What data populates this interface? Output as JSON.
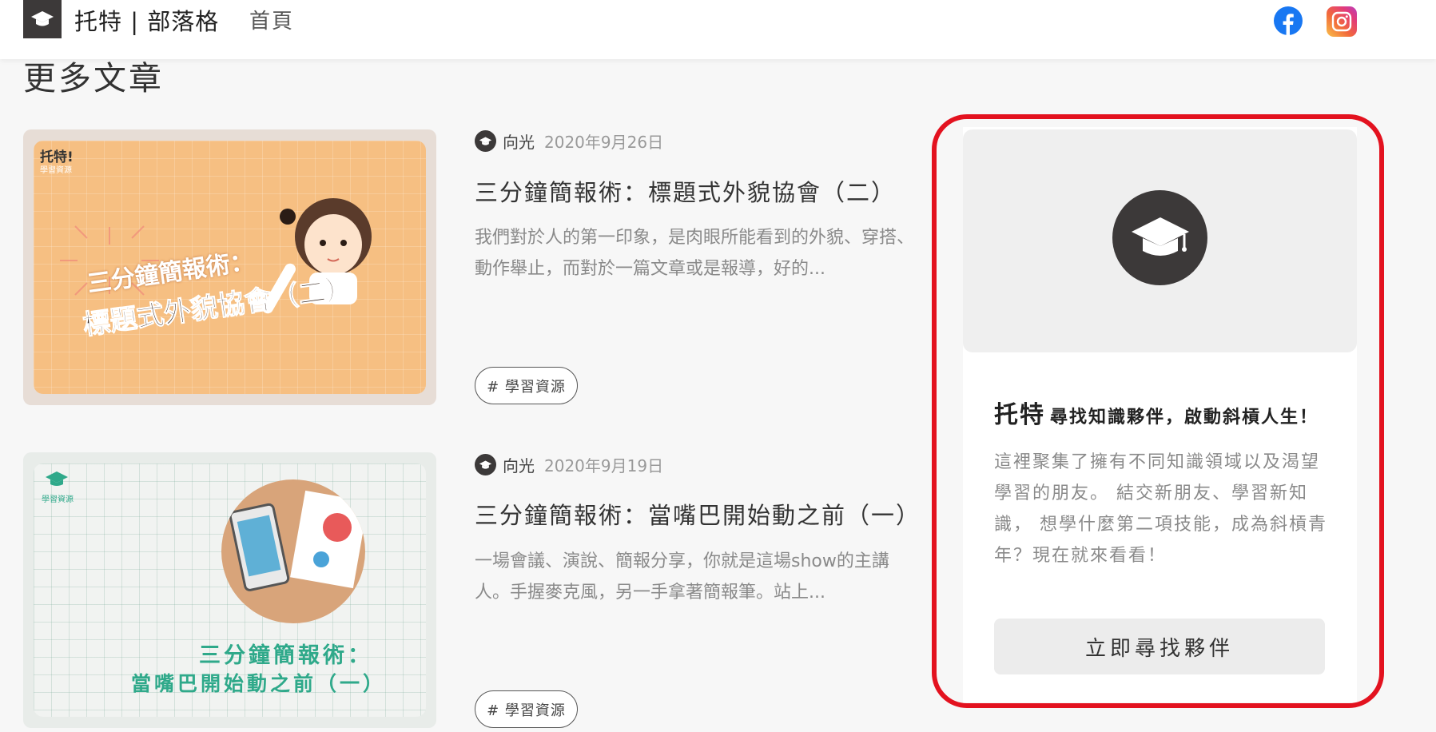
{
  "header": {
    "site_title": "托特 | 部落格",
    "nav_home": "首頁",
    "social": {
      "facebook_icon": "facebook-icon",
      "instagram_icon": "instagram-icon"
    },
    "colors": {
      "facebook": "#1877f2",
      "logo_bg": "#3c3939"
    }
  },
  "section": {
    "title": "更多文章"
  },
  "posts": [
    {
      "author": "向光",
      "date": "2020年9月26日",
      "title": "三分鐘簡報術：標題式外貌協會（二）",
      "excerpt": "我們對於人的第一印象，是肉眼所能看到的外貌、穿搭、動作舉止，而對於一篇文章或是報導，好的...",
      "tag": "# 學習資源",
      "thumbnail": {
        "badge": "托特!",
        "badge_sub": "學習資源",
        "line1": "三分鐘簡報術：",
        "line2": "標題式外貌協會（二）",
        "color": "#f6bf82"
      }
    },
    {
      "author": "向光",
      "date": "2020年9月19日",
      "title": "三分鐘簡報術：當嘴巴開始動之前（一）",
      "excerpt": "一場會議、演說、簡報分享，你就是這場show的主講人。手握麥克風，另一手拿著簡報筆。站上...",
      "tag": "# 學習資源",
      "thumbnail": {
        "badge_sub": "學習資源",
        "line1": "三分鐘簡報術：",
        "line2": "當嘴巴開始動之前（一）",
        "color": "#2fa98a"
      }
    }
  ],
  "side_card": {
    "brand": "托特",
    "slogan": "尋找知識夥伴，啟動斜槓人生！",
    "description": "這裡聚集了擁有不同知識領域以及渴望學習的朋友。 結交新朋友、學習新知識， 想學什麼第二項技能，成為斜槓青年？現在就來看看！",
    "button": "立即尋找夥伴",
    "logo_icon": "graduation-cap-icon",
    "highlight_color": "#e3121f"
  }
}
